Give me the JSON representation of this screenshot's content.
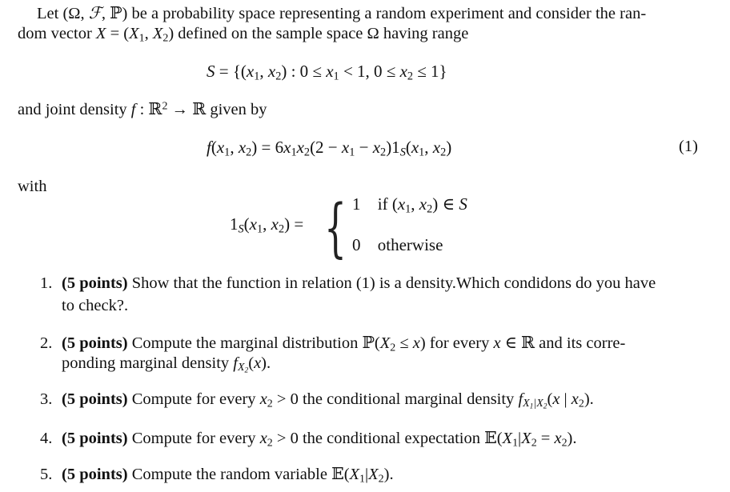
{
  "intro": {
    "line1": "Let (Ω, ℱ, ℙ) be a probability space representing a random experiment and consider the ran-",
    "line2": "dom vector X = (X₁, X₂) defined on the sample space Ω having range"
  },
  "range_equation": "S = {(x₁, x₂) : 0 ≤ x₁ < 1, 0 ≤ x₂ ≤ 1}",
  "joint_density_intro": "and joint density f : ℝ² → ℝ given by",
  "density_equation": {
    "text": "f(x₁, x₂) = 6x₁x₂(2 − x₁ − x₂)1_S(x₁, x₂)",
    "number": "(1)"
  },
  "with_label": "with",
  "indicator": {
    "lhs": "1_S(x₁, x₂) =",
    "case1_value": "1",
    "case1_condition": "if (x₁, x₂) ∈ S",
    "case2_value": "0",
    "case2_condition": "otherwise"
  },
  "questions": [
    {
      "number": "1.",
      "points": "(5 points)",
      "text": "Show that the function in relation (1) is a density.Which condidons do you have to check?."
    },
    {
      "number": "2.",
      "points": "(5 points)",
      "text": "Compute the marginal distribution ℙ(X₂ ≤ x) for every x ∈ ℝ and its corresponding marginal density f_X₂(x)."
    },
    {
      "number": "3.",
      "points": "(5 points)",
      "text": "Compute for every x₂ > 0 the conditional marginal density f_X₁|X₂(x | x₂)."
    },
    {
      "number": "4.",
      "points": "(5 points)",
      "text": "Compute for every x₂ > 0 the conditional expectation 𝔼(X₁|X₂ = x₂)."
    },
    {
      "number": "5.",
      "points": "(5 points)",
      "text": "Compute the random variable 𝔼(X₁|X₂)."
    }
  ],
  "display_parts": {
    "q1_line1": "Show that the function in relation (1) is a density.Which condidons do you have",
    "q1_line2": "to check?.",
    "q2_a": "Compute the marginal distribution ",
    "q2_b": " for every ",
    "q2_c": " and its corre-",
    "q2_line2_a": "ponding marginal density ",
    "q3_a": "Compute for every ",
    "q3_b": " the conditional marginal density ",
    "q4_a": "Compute for every ",
    "q4_b": " the conditional expectation ",
    "q5_a": "Compute the random variable "
  }
}
